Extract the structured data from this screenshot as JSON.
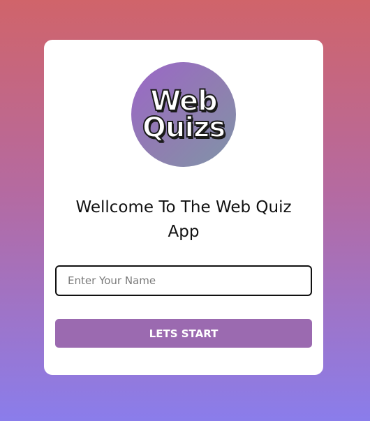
{
  "logo": {
    "line1": "Web",
    "line2": "Quizs"
  },
  "welcome": {
    "title": "Wellcome To The Web Quiz App"
  },
  "name_field": {
    "placeholder": "Enter Your Name",
    "value": ""
  },
  "start_button": {
    "label": "LETS START"
  },
  "colors": {
    "background_top": "#d0646a",
    "background_bottom": "#8a7deb",
    "button": "#9b6ab0",
    "card": "#ffffff"
  }
}
